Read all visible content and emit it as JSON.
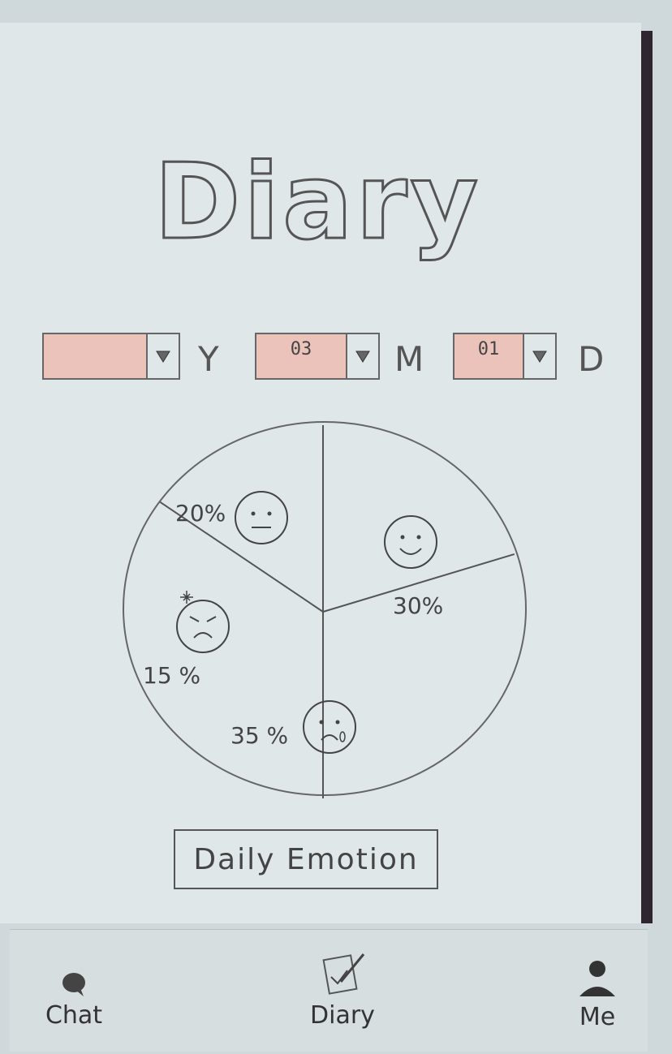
{
  "header": {
    "title": "Diary"
  },
  "date_picker": {
    "year": {
      "value": "",
      "unit": "Y"
    },
    "month": {
      "value": "03",
      "unit": "M"
    },
    "day": {
      "value": "01",
      "unit": "D"
    },
    "arrow_icon": "triangle-down-icon"
  },
  "chart_data": {
    "type": "pie",
    "slices": [
      {
        "emotion": "neutral",
        "value": 20,
        "label": "20%",
        "icon": "neutral-face-icon"
      },
      {
        "emotion": "happy",
        "value": 30,
        "label": "30%",
        "icon": "smile-face-icon"
      },
      {
        "emotion": "sad",
        "value": 35,
        "label": "35 %",
        "icon": "crying-face-icon"
      },
      {
        "emotion": "angry",
        "value": 15,
        "label": "15 %",
        "icon": "angry-face-icon"
      }
    ]
  },
  "main": {
    "button_label": "Daily Emotion"
  },
  "nav": {
    "items": [
      {
        "label": "Chat",
        "icon": "chat-bubble-icon"
      },
      {
        "label": "Diary",
        "icon": "diary-pen-icon"
      },
      {
        "label": "Me",
        "icon": "person-icon"
      }
    ]
  }
}
